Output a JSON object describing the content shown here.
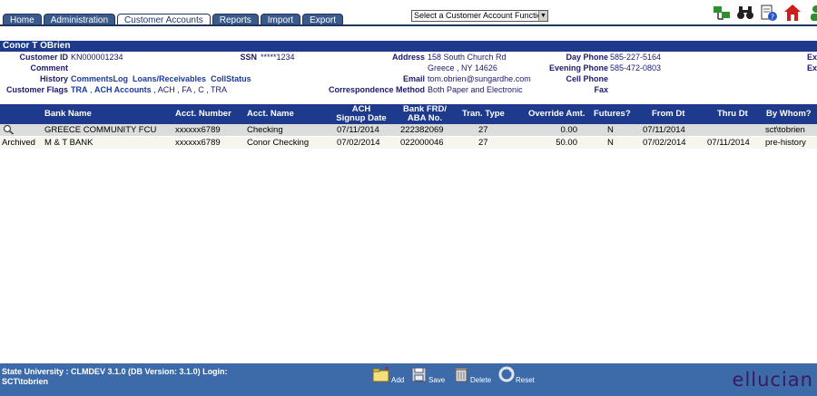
{
  "tabs": [
    "Home",
    "Administration",
    "Customer Accounts",
    "Reports",
    "Import",
    "Export"
  ],
  "function_select": "Select a Customer Account Function",
  "customer": {
    "name": "Conor T OBrien",
    "labels": {
      "customer_id": "Customer ID",
      "comment": "Comment",
      "history": "History",
      "flags": "Customer Flags",
      "ssn": "SSN",
      "address": "Address",
      "email": "Email",
      "corr": "Correspondence Method",
      "day_phone": "Day Phone",
      "eve_phone": "Evening Phone",
      "cell_phone": "Cell Phone",
      "fax": "Fax"
    },
    "customer_id": "KN000001234",
    "ssn": "*****1234",
    "address_line1": "158 South Church Rd",
    "address_line2": "Greece , NY 14626",
    "email": "tom.obrien@sungardhe.com",
    "correspondence": "Both Paper and Electronic",
    "day_phone": "585-227-5164",
    "evening_phone": "585-472-0803",
    "history_links": [
      "CommentsLog",
      "Loans/Receivables",
      "CollStatus"
    ],
    "flags_link1": "TRA",
    "flags_link2": "ACH Accounts",
    "flags_rest": ", ACH , FA , C , TRA",
    "ex1": "Ex",
    "ex2": "Ex"
  },
  "table": {
    "headers": {
      "bank": "Bank Name",
      "acct_num": "Acct. Number",
      "acct_name": "Acct. Name",
      "ach_1": "ACH",
      "ach_2": "Signup Date",
      "frd_1": "Bank FRD/",
      "frd_2": "ABA No.",
      "tran": "Tran. Type",
      "override": "Override Amt.",
      "futures": "Futures?",
      "from": "From Dt",
      "thru": "Thru Dt",
      "by": "By Whom?"
    },
    "rows": [
      {
        "status": "",
        "bank": "GREECE COMMUNITY FCU",
        "acct_num": "xxxxxx6789",
        "acct_name": "Checking",
        "signup": "07/11/2014",
        "aba": "222382069",
        "tran": "27",
        "override": "0.00",
        "futures": "N",
        "from": "07/11/2014",
        "thru": "",
        "by": "sct\\tobrien"
      },
      {
        "status": "Archived",
        "bank": "M & T BANK",
        "acct_num": "xxxxxx6789",
        "acct_name": "Conor Checking",
        "signup": "07/02/2014",
        "aba": "022000046",
        "tran": "27",
        "override": "50.00",
        "futures": "N",
        "from": "07/02/2014",
        "thru": "07/11/2014",
        "by": "pre-history"
      }
    ]
  },
  "footer": {
    "status_line1": "State University : CLMDEV 3.1.0 (DB Version: 3.1.0) Login:",
    "status_line2": "SCT\\tobrien",
    "add": "Add",
    "save": "Save",
    "delete": "Delete",
    "reset": "Reset",
    "logo": "ellucian"
  }
}
